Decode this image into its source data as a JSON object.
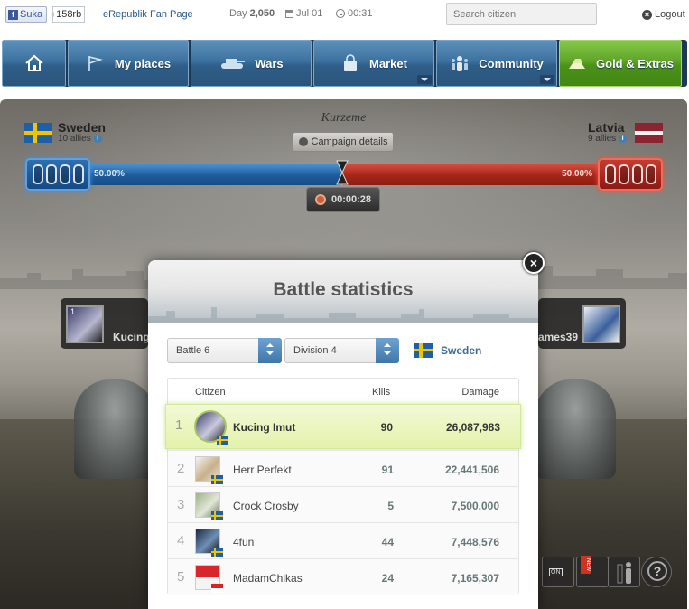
{
  "topbar": {
    "fb_like_label": "Suka",
    "fb_count": "158rb",
    "fan_page": "eRepublik Fan Page",
    "day_label": "Day",
    "day_value": "2,050",
    "date": "Jul 01",
    "time": "00:31",
    "search_placeholder": "Search citizen",
    "logout": "Logout"
  },
  "nav": {
    "items": [
      {
        "label": "",
        "icon": "home-icon"
      },
      {
        "label": "My places",
        "icon": "flag-icon"
      },
      {
        "label": "Wars",
        "icon": "tank-icon"
      },
      {
        "label": "Market",
        "icon": "bag-icon"
      },
      {
        "label": "Community",
        "icon": "people-icon"
      },
      {
        "label": "Gold & Extras",
        "icon": "gold-icon"
      }
    ]
  },
  "battle": {
    "region": "Kurzeme",
    "campaign_button": "Campaign details",
    "left": {
      "country": "Sweden",
      "allies": "10 allies",
      "percent": "50.00%",
      "color": "#1f5fa8"
    },
    "right": {
      "country": "Latvia",
      "allies": "9 allies",
      "percent": "50.00%",
      "color": "#8b2330"
    },
    "timer": "00:00:28",
    "left_fighter": {
      "name": "Kucing Imut",
      "rank": "1"
    },
    "right_fighter": {
      "name": "james39"
    },
    "hud": {
      "on_label": "ON",
      "new_label": "NEW",
      "help": "?"
    }
  },
  "modal": {
    "title": "Battle statistics",
    "battle_select": "Battle 6",
    "division_select": "Division 4",
    "country": "Sweden",
    "columns": {
      "citizen": "Citizen",
      "kills": "Kills",
      "damage": "Damage"
    },
    "rows": [
      {
        "rank": "1",
        "name": "Kucing Imut",
        "kills": "90",
        "damage": "26,087,983",
        "flag": "sweden"
      },
      {
        "rank": "2",
        "name": "Herr Perfekt",
        "kills": "91",
        "damage": "22,441,506",
        "flag": "sweden"
      },
      {
        "rank": "3",
        "name": "Crock Crosby",
        "kills": "5",
        "damage": "7,500,000",
        "flag": "sweden"
      },
      {
        "rank": "4",
        "name": "4fun",
        "kills": "44",
        "damage": "7,448,576",
        "flag": "sweden"
      },
      {
        "rank": "5",
        "name": "MadamChikas",
        "kills": "24",
        "damage": "7,165,307",
        "flag": "indonesia"
      }
    ]
  }
}
